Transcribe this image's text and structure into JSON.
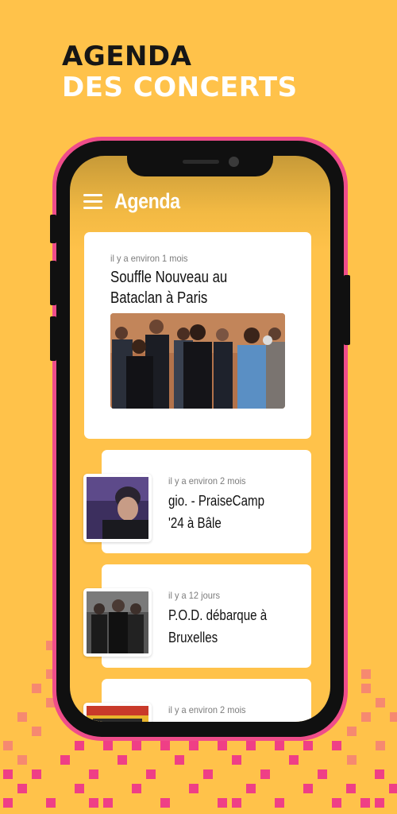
{
  "headline": {
    "line1": "AGENDA",
    "line2": "DES CONCERTS"
  },
  "app": {
    "title": "Agenda",
    "menu_icon": "hamburger-menu-icon"
  },
  "featured_event": {
    "meta": "il y a environ 1 mois",
    "title": "Souffle Nouveau au Bataclan à Paris",
    "image": "band-group-photo"
  },
  "events": [
    {
      "meta": "il y a environ 2 mois",
      "title": "gio. - PraiseCamp '24 à Bâle",
      "image": "artist-portrait"
    },
    {
      "meta": "il y a 12 jours",
      "title": "P.O.D. débarque à Bruxelles",
      "image": "band-photo"
    },
    {
      "meta": "il y a environ 2 mois",
      "title": "",
      "image": "poster"
    }
  ],
  "colors": {
    "background": "#FFC24A",
    "accent": "#EF4D8A",
    "phone": "#101010",
    "card": "#FFFFFF"
  }
}
